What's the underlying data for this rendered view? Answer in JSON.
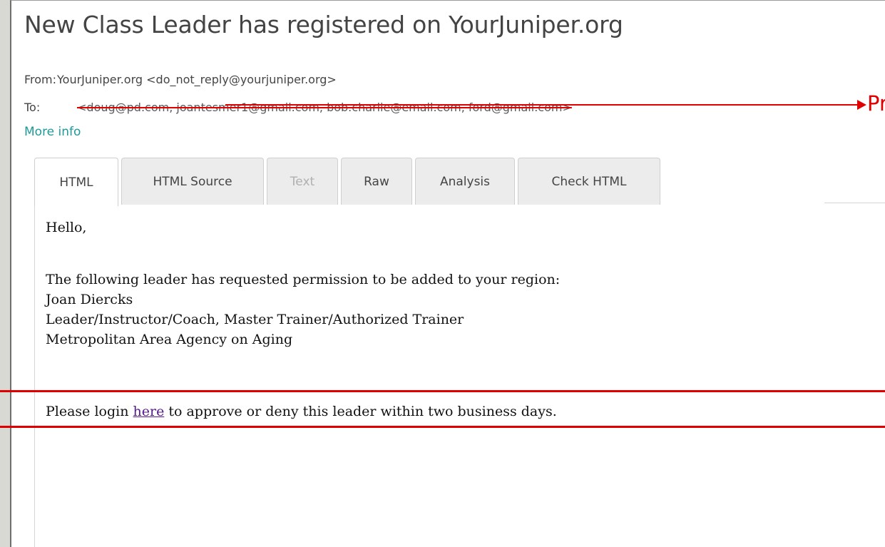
{
  "email": {
    "subject": "New Class Leader has registered on YourJuniper.org",
    "from_label": "From:",
    "from_value": "YourJuniper.org <do_not_reply@yourjuniper.org>",
    "to_label": "To:",
    "to_value": "<doug@pd.com, joantesmer1@gmail.com, bob.charlie@email.com, ford@gmail.com>",
    "more_info": "More info"
  },
  "annotation": {
    "text": "Prog",
    "color": "#e00000"
  },
  "tabs": [
    {
      "label": "HTML",
      "active": true,
      "disabled": false
    },
    {
      "label": "HTML Source",
      "active": false,
      "disabled": false
    },
    {
      "label": "Text",
      "active": false,
      "disabled": true
    },
    {
      "label": "Raw",
      "active": false,
      "disabled": false
    },
    {
      "label": "Analysis",
      "active": false,
      "disabled": false
    },
    {
      "label": "Check HTML",
      "active": false,
      "disabled": false
    }
  ],
  "message": {
    "greeting": "Hello,",
    "intro": "The following leader has requested permission to be added to your region:",
    "leader_name": "Joan Diercks",
    "leader_role": "Leader/Instructor/Coach, Master Trainer/Authorized Trainer",
    "leader_org": "Metropolitan Area Agency on Aging",
    "login_prefix": "Please login ",
    "login_link": "here",
    "login_suffix": " to approve or deny this leader within two business days."
  },
  "colors": {
    "accent_link": "#1f9a9a",
    "visited_link": "#551a8b",
    "annotation_red": "#e00000"
  }
}
